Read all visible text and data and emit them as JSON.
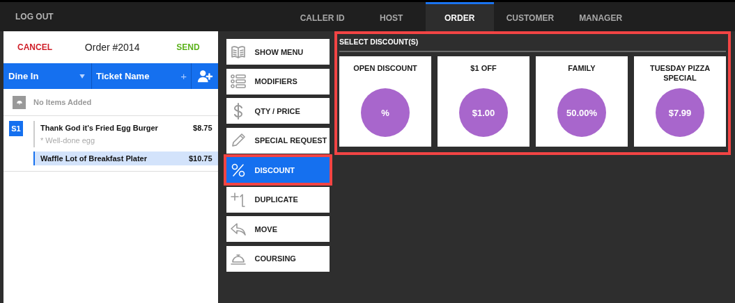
{
  "top_bar": {
    "logout": "LOG OUT",
    "tabs": [
      {
        "label": "CALLER ID",
        "selected": false
      },
      {
        "label": "HOST",
        "selected": false
      },
      {
        "label": "ORDER",
        "selected": true
      },
      {
        "label": "CUSTOMER",
        "selected": false
      },
      {
        "label": "MANAGER",
        "selected": false
      }
    ]
  },
  "ticket": {
    "cancel": "CANCEL",
    "title": "Order #2014",
    "send": "SEND",
    "order_type": "Dine In",
    "ticket_name": "Ticket Name",
    "ticket_name_add": "+",
    "no_items": "No Items Added",
    "seats": [
      {
        "seat": "S1",
        "items": [
          {
            "name": "Thank God it's Fried Egg Burger",
            "price": "$8.75",
            "modifier": "* Well-done egg",
            "selected": false
          },
          {
            "name": "Waffle Lot of Breakfast Plater",
            "price": "$10.75",
            "selected": true
          }
        ]
      }
    ]
  },
  "actions": [
    {
      "label": "SHOW MENU",
      "selected": false,
      "highlighted": false
    },
    {
      "label": "MODIFIERS",
      "selected": false,
      "highlighted": false
    },
    {
      "label": "QTY / PRICE",
      "selected": false,
      "highlighted": false
    },
    {
      "label": "SPECIAL REQUEST",
      "selected": false,
      "highlighted": false
    },
    {
      "label": "DISCOUNT",
      "selected": true,
      "highlighted": true
    },
    {
      "label": "DUPLICATE",
      "selected": false,
      "highlighted": false
    },
    {
      "label": "MOVE",
      "selected": false,
      "highlighted": false
    },
    {
      "label": "COURSING",
      "selected": false,
      "highlighted": false
    }
  ],
  "discount_panel": {
    "title": "SELECT DISCOUNT(S)",
    "highlighted": true,
    "discounts": [
      {
        "name": "OPEN DISCOUNT",
        "value": "%"
      },
      {
        "name": "$1 OFF",
        "value": "$1.00"
      },
      {
        "name": "FAMILY",
        "value": "50.00%"
      },
      {
        "name": "TUESDAY PIZZA SPECIAL",
        "value": "$7.99"
      }
    ]
  }
}
